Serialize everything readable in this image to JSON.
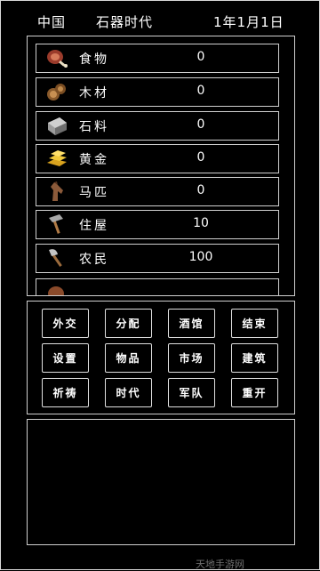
{
  "header": {
    "country": "中国",
    "era": "石器时代",
    "date": "1年1月1日"
  },
  "resources": [
    {
      "name": "食物",
      "value": "0",
      "icon": "meat-icon"
    },
    {
      "name": "木材",
      "value": "0",
      "icon": "wood-icon"
    },
    {
      "name": "石料",
      "value": "0",
      "icon": "stone-icon"
    },
    {
      "name": "黄金",
      "value": "0",
      "icon": "gold-icon"
    },
    {
      "name": "马匹",
      "value": "0",
      "icon": "horse-icon"
    },
    {
      "name": "住屋",
      "value": "10",
      "icon": "hammer-icon"
    },
    {
      "name": "农民",
      "value": "100",
      "icon": "axe-icon"
    },
    {
      "name": "",
      "value": "",
      "icon": "partial-icon"
    }
  ],
  "buttons": [
    [
      "外交",
      "分配",
      "酒馆",
      "结束"
    ],
    [
      "设置",
      "物品",
      "市场",
      "建筑"
    ],
    [
      "祈祷",
      "时代",
      "军队",
      "重开"
    ]
  ],
  "watermark": "天地手游网",
  "colors": {
    "background": "#000000",
    "border": "#d0d0d0",
    "text": "#ffffff"
  }
}
